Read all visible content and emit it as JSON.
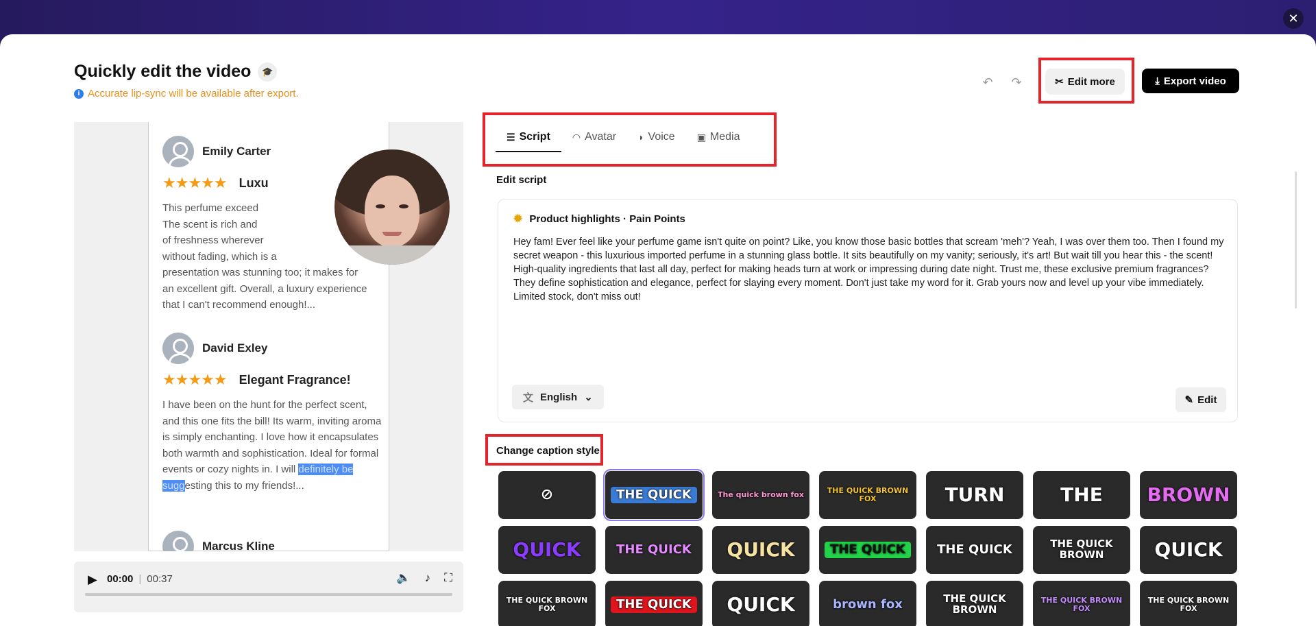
{
  "header": {
    "title": "Quickly edit the video",
    "notice": "Accurate lip-sync will be available after export.",
    "edit_more": "Edit more",
    "export": "Export video"
  },
  "preview": {
    "reviews": [
      {
        "name": "Emily Carter",
        "headline": "Luxu",
        "body_before": "This perfume exceed… The scent is rich and… of freshness wherever… without fading, which is a… presentation was stunning too; it makes for an excellent gift. Overall, a luxury experience that I can't recommend enough!...",
        "stars": "★★★★★"
      },
      {
        "name": "David Exley",
        "headline": "Elegant Fragrance!",
        "body_before": "I have been on the hunt for the perfect scent, and this one fits the bill! Its warm, inviting aroma is simply enchanting. I love how it encapsulates both warmth and sophistication. Ideal for formal events or cozy nights in. I will ",
        "body_sel": "definitely be sugg",
        "body_after": "esting this to my friends!...",
        "stars": "★★★★★"
      },
      {
        "name": "Marcus Kline"
      }
    ],
    "r1_lines": [
      "This perfume exceed",
      "The scent is rich and",
      "of freshness wherever",
      "without fading, which is a",
      "presentation was stunning too; it makes for",
      "an excellent gift. Overall, a luxury experience",
      "that I can't recommend enough!..."
    ]
  },
  "player": {
    "current": "00:00",
    "duration": "00:37"
  },
  "tabs": [
    {
      "label": "Script",
      "icon": "script-icon"
    },
    {
      "label": "Avatar",
      "icon": "avatar-icon"
    },
    {
      "label": "Voice",
      "icon": "voice-icon"
    },
    {
      "label": "Media",
      "icon": "media-icon"
    }
  ],
  "script": {
    "section_label": "Edit script",
    "heading": "Product highlights · Pain Points",
    "text": "Hey fam! Ever feel like your perfume game isn't quite on point? Like, you know those basic bottles that scream 'meh'? Yeah, I was over them too. Then I found my secret weapon - this luxurious imported perfume in a stunning glass bottle. It sits beautifully on my vanity; seriously, it's art! But wait till you hear this - the scent! High-quality ingredients that last all day, perfect for making heads turn at work or impressing during date night. Trust me, these exclusive premium fragrances? They define sophistication and elegance, perfect for slaying every moment. Don't just take my word for it. Grab yours now and level up your vibe immediately. Limited stock, don't miss out!",
    "language": "English",
    "edit": "Edit"
  },
  "captions": {
    "section_label": "Change caption style",
    "styles": [
      {
        "text": "⊘",
        "fg": "#ffffff"
      },
      {
        "text": "THE QUICK",
        "fg": "#ffffff",
        "bg": "#3a7bd5"
      },
      {
        "text": "The quick brown fox",
        "fg": "#ff9ad5"
      },
      {
        "text": "THE QUICK BROWN FOX",
        "fg": "#f4c430"
      },
      {
        "text": "TURN",
        "fg": "#ffffff"
      },
      {
        "text": "THE",
        "fg": "#ffffff"
      },
      {
        "text": "BROWN",
        "fg": "#e26bf0"
      },
      {
        "text": "QUICK",
        "fg": "#8b3dff"
      },
      {
        "text": "THE QUICK",
        "fg": "#e68bff"
      },
      {
        "text": "QUICK",
        "fg": "#f7e3a1"
      },
      {
        "text": "THE QUICK",
        "fg": "#111111",
        "bg": "#22d34a"
      },
      {
        "text": "THE QUICK",
        "fg": "#ffffff"
      },
      {
        "text": "THE QUICK BROWN",
        "fg": "#ffffff"
      },
      {
        "text": "QUICK",
        "fg": "#ffffff"
      },
      {
        "text": "THE QUICK BROWN FOX",
        "fg": "#ffffff"
      },
      {
        "text": "THE QUICK",
        "fg": "#ffffff",
        "bg": "#e0141c"
      },
      {
        "text": "QUICK",
        "fg": "#ffffff"
      },
      {
        "text": "brown fox",
        "fg": "#a9b4ff"
      },
      {
        "text": "THE QUICK BROWN",
        "fg": "#ffffff"
      },
      {
        "text": "THE QUICK BROWN FOX",
        "fg": "#c58cff"
      },
      {
        "text": "THE QUICK BROWN FOX",
        "fg": "#ffffff"
      }
    ]
  },
  "colors": {
    "accent": "#e3242b",
    "warning": "#e8901a",
    "selection": "#4d8df5"
  }
}
